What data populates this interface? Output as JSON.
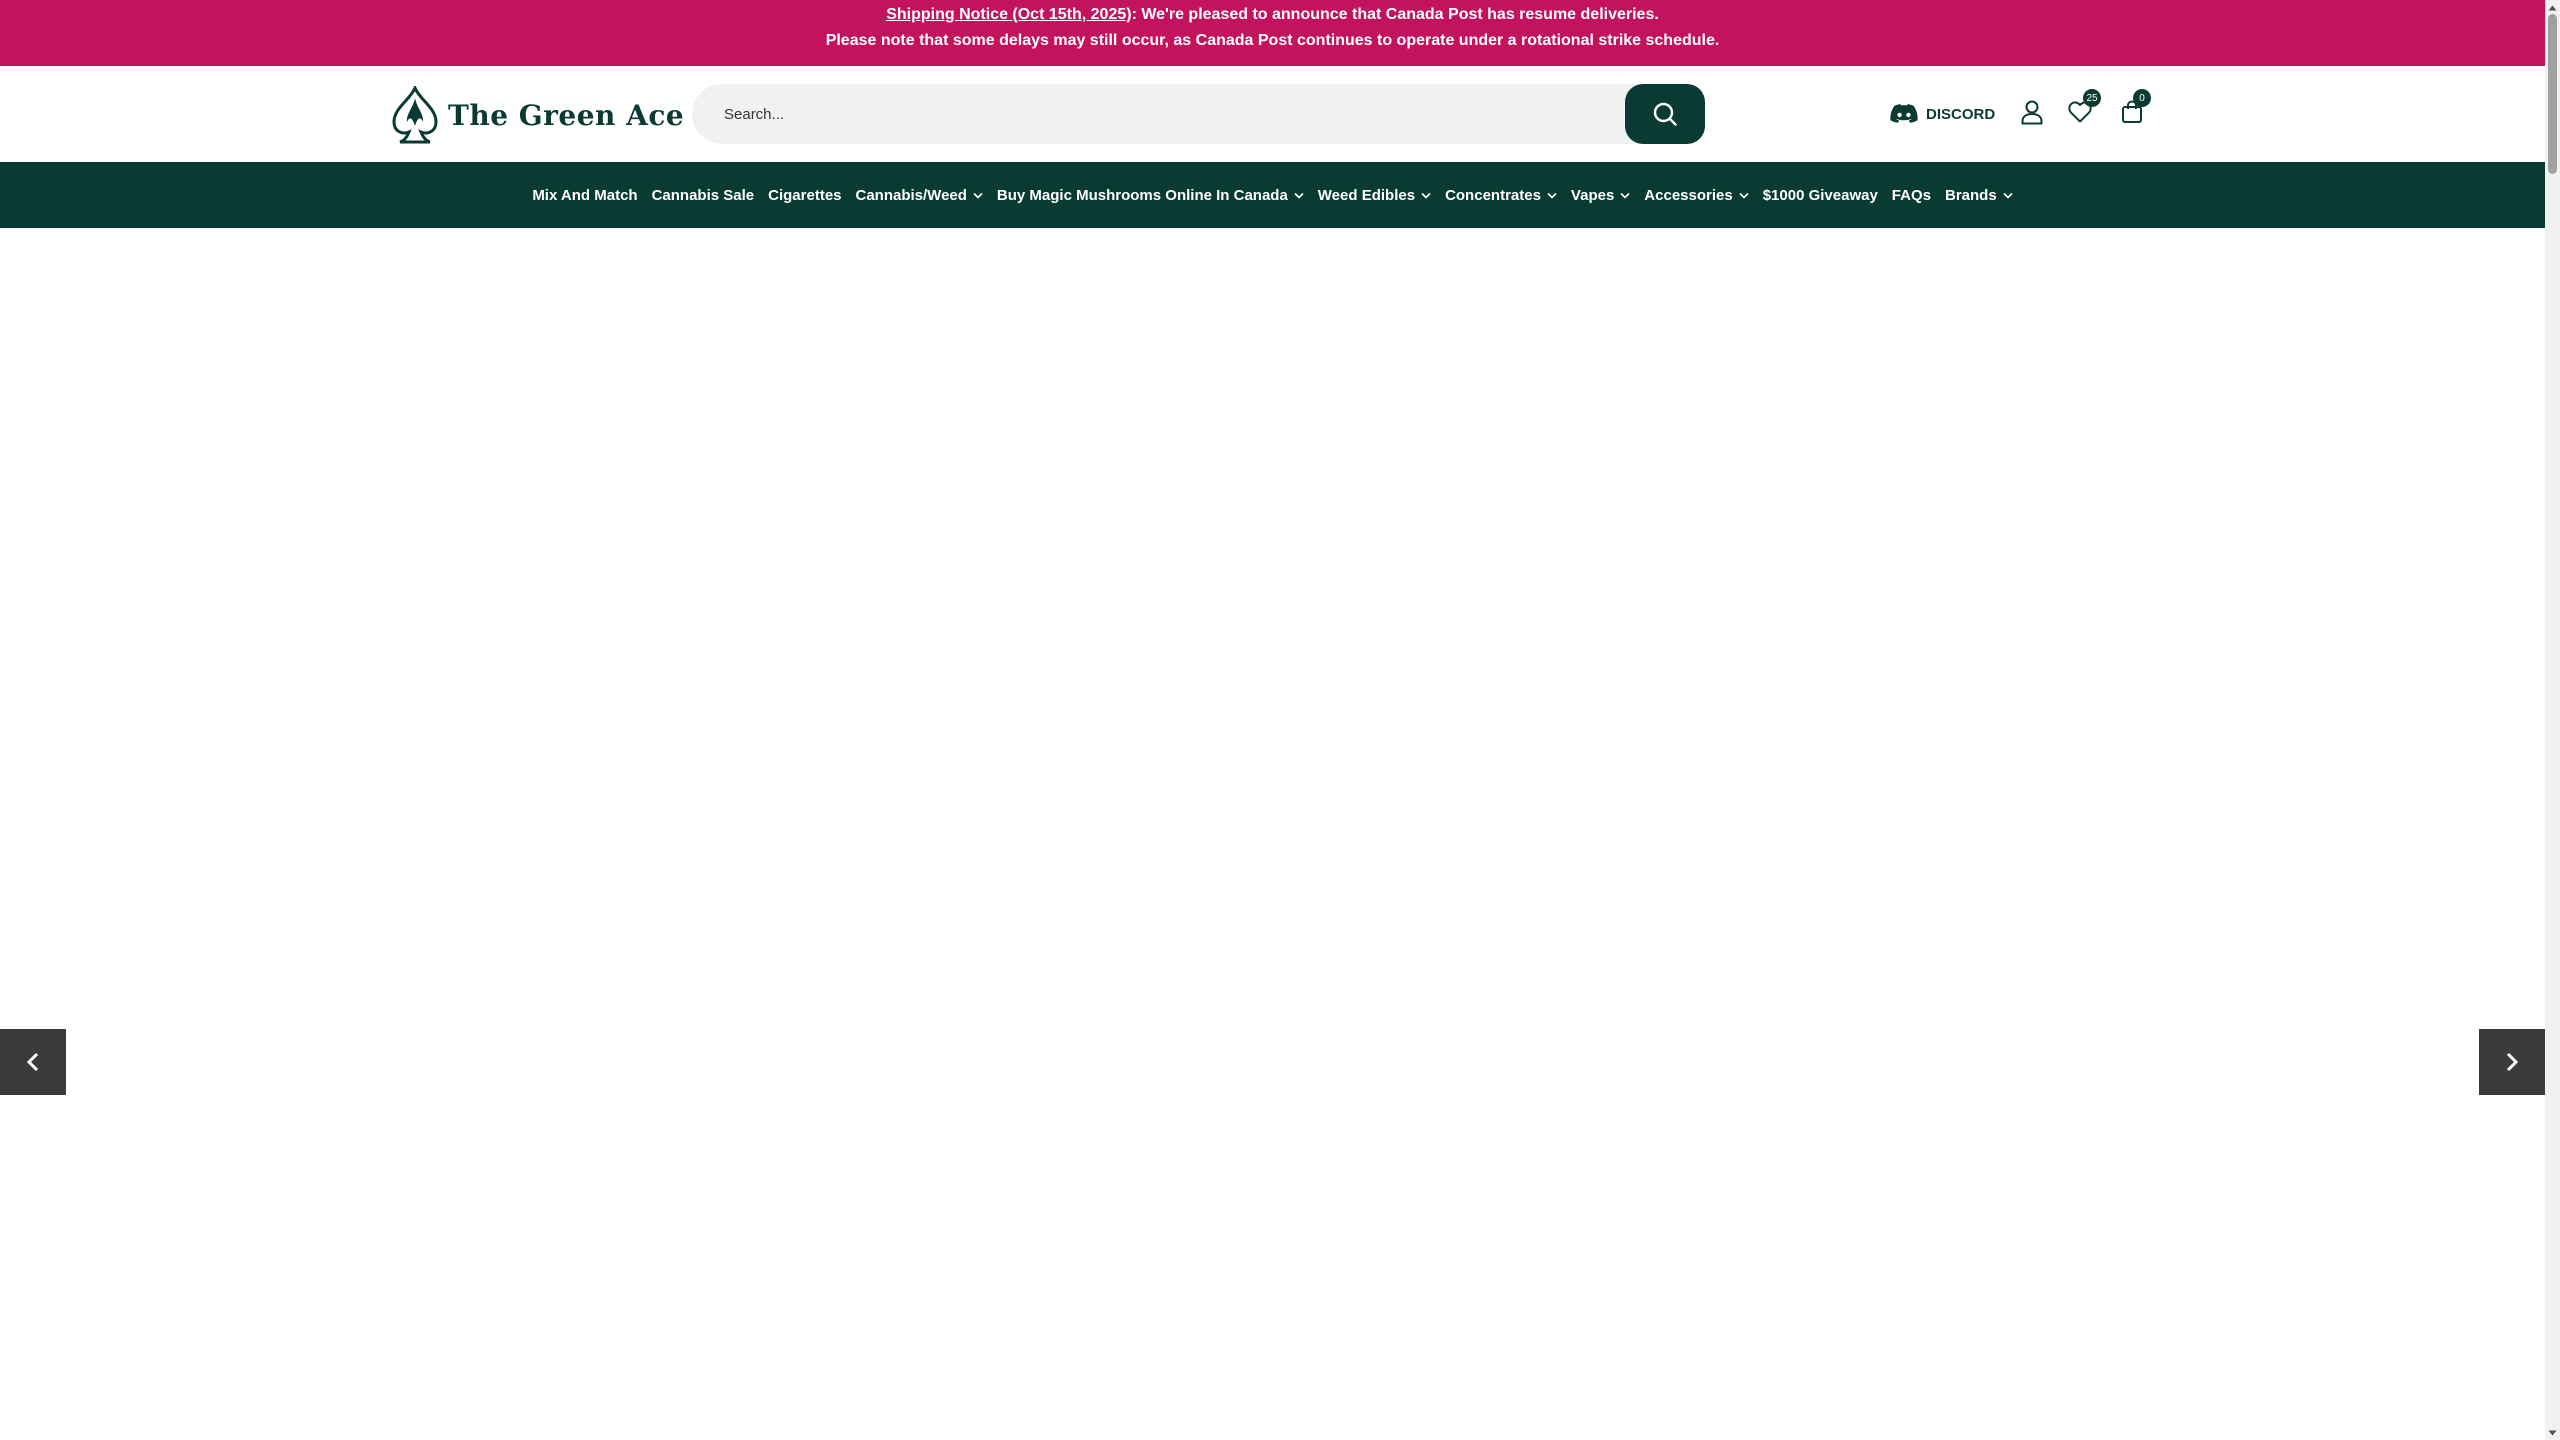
{
  "announcement": {
    "notice_link": "Shipping Notice (Oct 15th, 2025)",
    "line1_rest": ": We're pleased to announce that Canada Post has resume deliveries.",
    "line2": "Please note that some delays may still occur, as Canada Post continues to operate under a rotational strike schedule."
  },
  "header": {
    "logo_text": "The Green Ace",
    "search_placeholder": "Search...",
    "discord_label": "DISCORD",
    "wishlist_count": "25",
    "cart_count": "0"
  },
  "nav": {
    "items": [
      {
        "label": "Mix And Match"
      },
      {
        "label": "Cannabis Sale"
      },
      {
        "label": "Cigarettes"
      },
      {
        "label": "Cannabis/Weed"
      },
      {
        "label": "Buy Magic Mushrooms Online In Canada"
      },
      {
        "label": "Weed Edibles"
      },
      {
        "label": "Concentrates"
      },
      {
        "label": "Vapes"
      },
      {
        "label": "Accessories"
      },
      {
        "label": "$1000 Giveaway"
      },
      {
        "label": "FAQs"
      },
      {
        "label": "Brands"
      }
    ]
  },
  "colors": {
    "announcement_bg": "#c3135e",
    "brand_dark_green": "#0a3b33",
    "slider_arrow_bg": "#3b3b3b"
  },
  "icons": {
    "search": "search-icon",
    "discord": "discord-icon",
    "account": "user-icon",
    "wishlist": "heart-icon",
    "cart": "shopping-bag-icon",
    "prev": "chevron-left-icon",
    "next": "chevron-right-icon"
  }
}
